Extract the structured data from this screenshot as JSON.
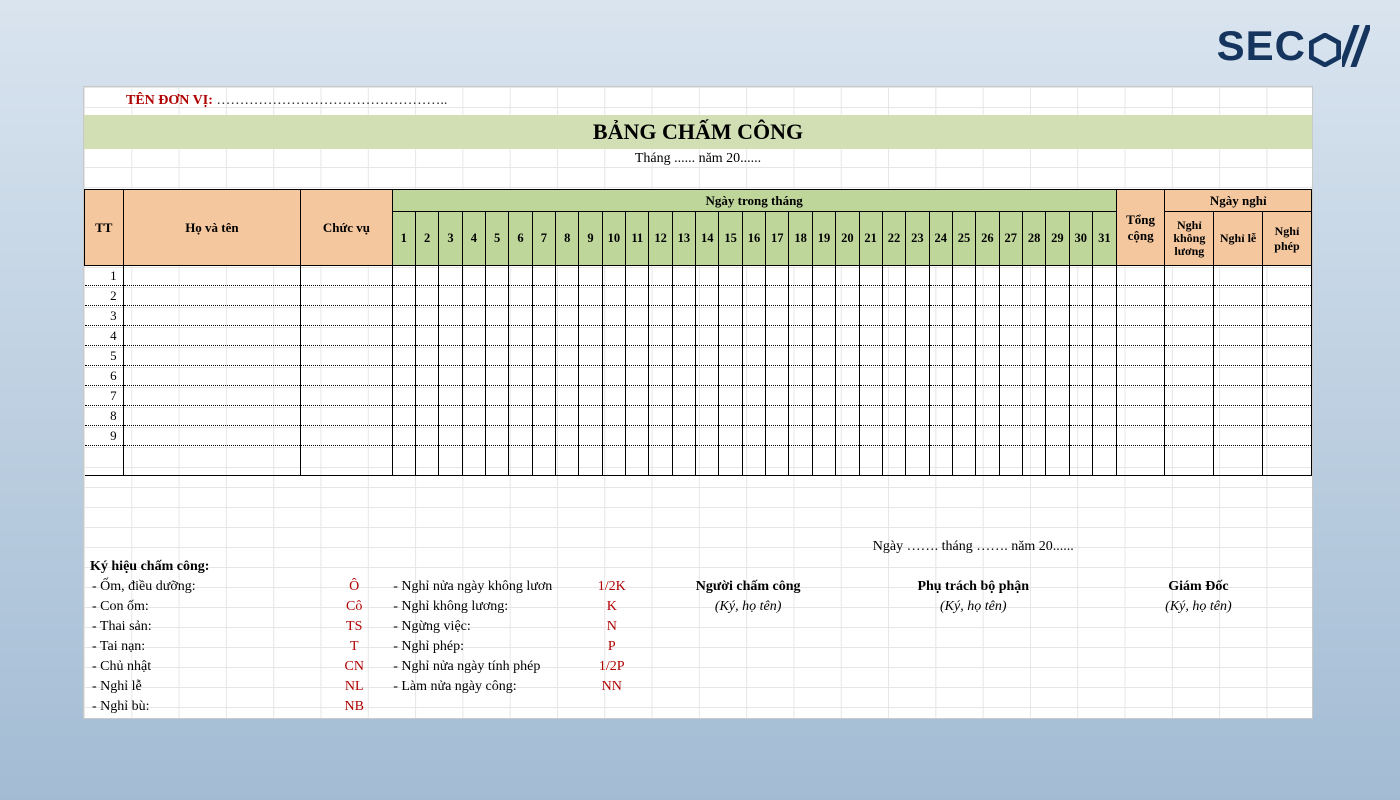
{
  "brand": {
    "name": "SECOM"
  },
  "header": {
    "org_label": "TÊN ĐƠN VỊ:",
    "org_dots": "…………………………………………..",
    "title": "BẢNG CHẤM CÔNG",
    "subtitle": "Tháng ...... năm 20......"
  },
  "columns": {
    "tt": "TT",
    "name": "Họ và tên",
    "position": "Chức vụ",
    "days_header": "Ngày trong tháng",
    "days": [
      "1",
      "2",
      "3",
      "4",
      "5",
      "6",
      "7",
      "8",
      "9",
      "10",
      "11",
      "12",
      "13",
      "14",
      "15",
      "16",
      "17",
      "18",
      "19",
      "20",
      "21",
      "22",
      "23",
      "24",
      "25",
      "26",
      "27",
      "28",
      "29",
      "30",
      "31"
    ],
    "total": "Tổng cộng",
    "leave_header": "Ngày nghỉ",
    "leave_unpaid": "Nghỉ không lương",
    "leave_holiday": "Nghỉ lễ",
    "leave_annual": "Nghỉ phép"
  },
  "rows": [
    "1",
    "2",
    "3",
    "4",
    "5",
    "6",
    "7",
    "8",
    "9"
  ],
  "footer": {
    "date_line": "Ngày ……. tháng ……. năm 20......",
    "legend_title": "Ký hiệu chấm công:",
    "legend_left": [
      {
        "label": "- Ốm, điều dưỡng:",
        "code": "Ô"
      },
      {
        "label": "- Con ốm:",
        "code": "Cô"
      },
      {
        "label": "- Thai sản:",
        "code": "TS"
      },
      {
        "label": "- Tai nạn:",
        "code": "T"
      },
      {
        "label": "- Chủ nhật",
        "code": "CN"
      },
      {
        "label": "- Nghỉ lễ",
        "code": "NL"
      },
      {
        "label": "- Nghỉ bù:",
        "code": "NB"
      }
    ],
    "legend_right": [
      {
        "label": "- Nghỉ nửa ngày không lươn",
        "code": "1/2K"
      },
      {
        "label": "- Nghỉ không lương:",
        "code": "K"
      },
      {
        "label": "- Ngừng việc:",
        "code": "N"
      },
      {
        "label": "- Nghỉ phép:",
        "code": "P"
      },
      {
        "label": "- Nghỉ nửa ngày tính phép",
        "code": "1/2P"
      },
      {
        "label": "- Làm nửa ngày công:",
        "code": "NN"
      }
    ],
    "sig1_title": "Người chấm công",
    "sig2_title": "Phụ trách bộ phận",
    "sig3_title": "Giám Đốc",
    "sig_sub": "(Ký, họ tên)"
  }
}
